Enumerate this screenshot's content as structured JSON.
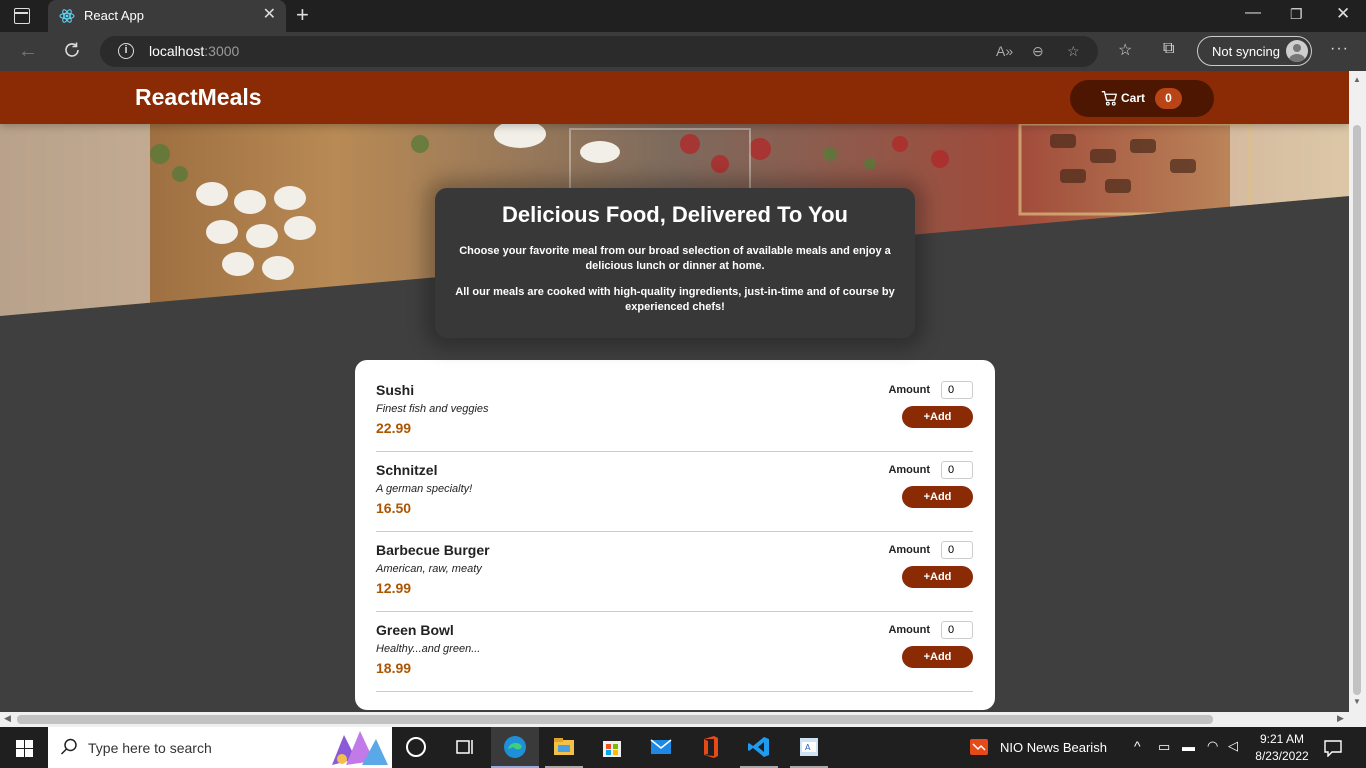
{
  "browser": {
    "tab_title": "React App",
    "url_host": "localhost",
    "url_port": ":3000",
    "sync_label": "Not syncing"
  },
  "header": {
    "logo": "ReactMeals",
    "cart_label": "Cart",
    "cart_count": "0"
  },
  "summary": {
    "title": "Delicious Food, Delivered To You",
    "paragraph1": "Choose your favorite meal from our broad selection of available meals and enjoy a delicious lunch or dinner at home.",
    "paragraph2": "All our meals are cooked with high-quality ingredients, just-in-time and of course by experienced chefs!"
  },
  "meals": [
    {
      "name": "Sushi",
      "description": "Finest fish and veggies",
      "price": "22.99",
      "amount_label": "Amount",
      "amount": "0",
      "add_label": "+Add"
    },
    {
      "name": "Schnitzel",
      "description": "A german specialty!",
      "price": "16.50",
      "amount_label": "Amount",
      "amount": "0",
      "add_label": "+Add"
    },
    {
      "name": "Barbecue Burger",
      "description": "American, raw, meaty",
      "price": "12.99",
      "amount_label": "Amount",
      "amount": "0",
      "add_label": "+Add"
    },
    {
      "name": "Green Bowl",
      "description": "Healthy...and green...",
      "price": "18.99",
      "amount_label": "Amount",
      "amount": "0",
      "add_label": "+Add"
    }
  ],
  "taskbar": {
    "search_placeholder": "Type here to search",
    "news_text": "NIO  News Bearish",
    "time": "9:21 AM",
    "date": "8/23/2022"
  },
  "colors": {
    "header": "#8a2b06",
    "cart_button": "#4d1601",
    "badge": "#b94517",
    "price": "#ad5502",
    "page_background": "#3f3f3f",
    "summary_background": "#383838"
  }
}
